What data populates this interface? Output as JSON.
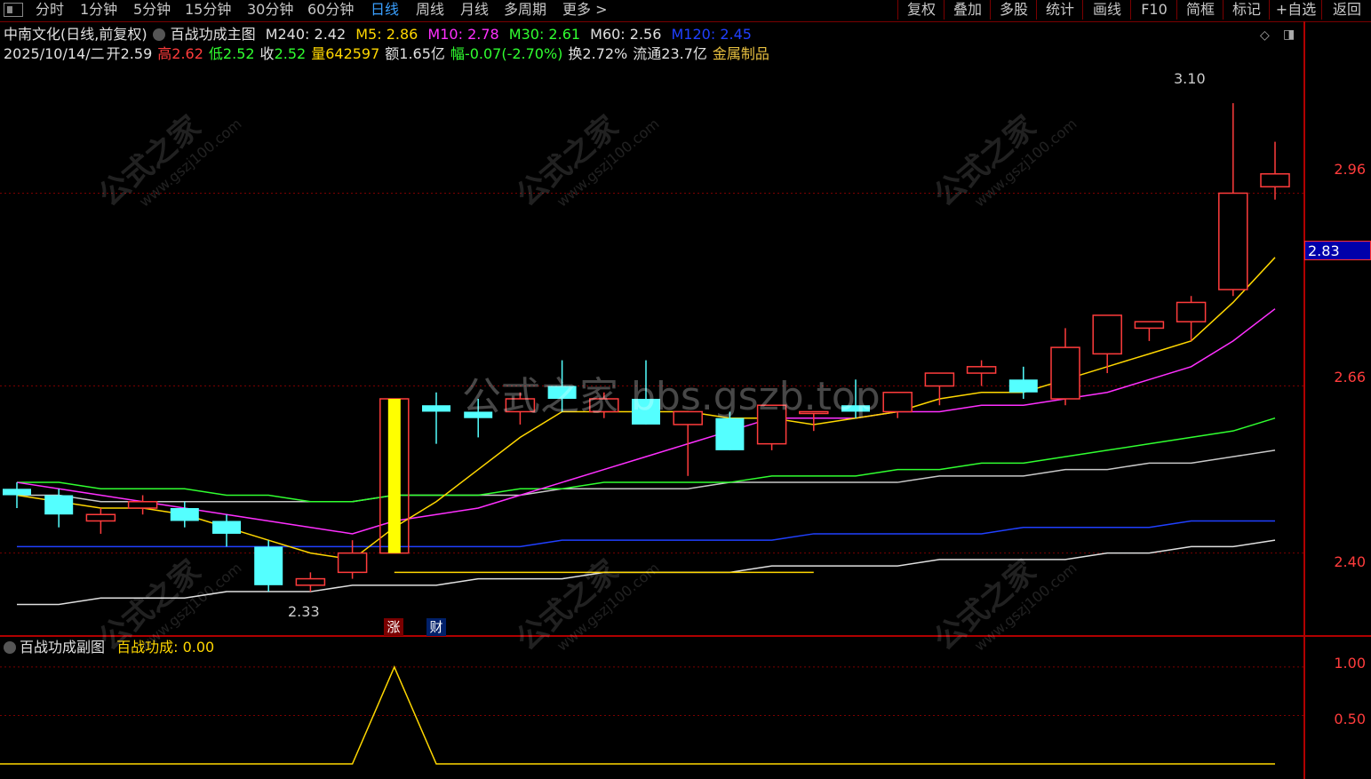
{
  "toolbar": {
    "periods": [
      "分时",
      "1分钟",
      "5分钟",
      "15分钟",
      "30分钟",
      "60分钟",
      "日线",
      "周线",
      "月线",
      "多周期",
      "更多 >"
    ],
    "active_period": "日线",
    "buttons": [
      "复权",
      "叠加",
      "多股",
      "统计",
      "画线",
      "F10",
      "简框",
      "标记",
      "+自选",
      "返回"
    ]
  },
  "header": {
    "stock": "中南文化(日线,前复权)",
    "indicator": "百战功成主图",
    "m240": "M240: 2.42",
    "m5": "M5: 2.86",
    "m10": "M10: 2.78",
    "m30": "M30: 2.61",
    "m60": "M60: 2.56",
    "m120": "M120: 2.45"
  },
  "quote": {
    "date": "2025/10/14/二",
    "open": "开2.59",
    "high_label": "高",
    "high": "2.62",
    "low_label": "低",
    "low": "2.52",
    "close_label": "收",
    "close": "2.52",
    "vol_label": "量",
    "vol": "642597",
    "amount": "额1.65亿",
    "change_label": "幅",
    "change": "-0.07(-2.70%)",
    "turnover": "换2.72%",
    "float": "流通23.7亿",
    "industry": "金属制品"
  },
  "axis": {
    "price_labels": [
      "2.96",
      "2.66",
      "2.40"
    ],
    "current_price": "2.83",
    "sub_labels": [
      "1.00",
      "0.50"
    ]
  },
  "annotations": {
    "high_mark": "3.10",
    "low_mark": "2.33",
    "tag_zhang": "涨",
    "tag_cai": "财"
  },
  "sub_panel": {
    "title": "百战功成副图",
    "value_label": "百战功成: 0.00"
  },
  "watermark": {
    "center": "公式之家 bbs.gszb.top",
    "text": "公式之家",
    "url": "www.gszj100.com"
  },
  "colors": {
    "up": "#ff3c3c",
    "down": "#54ffff",
    "m5": "#ffd700",
    "m10": "#ff30ff",
    "m30": "#30ff30",
    "m60": "#e0e0e0",
    "m120": "#2040ff",
    "m240": "#e0e0e0"
  },
  "chart_data": {
    "type": "candlestick",
    "candles": [
      {
        "o": 2.5,
        "h": 2.51,
        "l": 2.47,
        "c": 2.49
      },
      {
        "o": 2.49,
        "h": 2.5,
        "l": 2.44,
        "c": 2.46
      },
      {
        "o": 2.45,
        "h": 2.47,
        "l": 2.43,
        "c": 2.46
      },
      {
        "o": 2.47,
        "h": 2.49,
        "l": 2.46,
        "c": 2.48
      },
      {
        "o": 2.47,
        "h": 2.48,
        "l": 2.44,
        "c": 2.45
      },
      {
        "o": 2.45,
        "h": 2.46,
        "l": 2.41,
        "c": 2.43
      },
      {
        "o": 2.41,
        "h": 2.42,
        "l": 2.34,
        "c": 2.35
      },
      {
        "o": 2.35,
        "h": 2.37,
        "l": 2.34,
        "c": 2.36
      },
      {
        "o": 2.37,
        "h": 2.42,
        "l": 2.36,
        "c": 2.4
      },
      {
        "o": 2.4,
        "h": 2.64,
        "l": 2.4,
        "c": 2.64,
        "highlight": true
      },
      {
        "o": 2.63,
        "h": 2.65,
        "l": 2.57,
        "c": 2.62
      },
      {
        "o": 2.62,
        "h": 2.64,
        "l": 2.58,
        "c": 2.61
      },
      {
        "o": 2.62,
        "h": 2.65,
        "l": 2.6,
        "c": 2.64
      },
      {
        "o": 2.66,
        "h": 2.7,
        "l": 2.62,
        "c": 2.64
      },
      {
        "o": 2.62,
        "h": 2.65,
        "l": 2.61,
        "c": 2.64
      },
      {
        "o": 2.64,
        "h": 2.7,
        "l": 2.6,
        "c": 2.6
      },
      {
        "o": 2.6,
        "h": 2.62,
        "l": 2.52,
        "c": 2.62
      },
      {
        "o": 2.61,
        "h": 2.62,
        "l": 2.56,
        "c": 2.56
      },
      {
        "o": 2.57,
        "h": 2.63,
        "l": 2.56,
        "c": 2.63
      },
      {
        "o": 2.62,
        "h": 2.62,
        "l": 2.59,
        "c": 2.62
      },
      {
        "o": 2.63,
        "h": 2.67,
        "l": 2.61,
        "c": 2.62
      },
      {
        "o": 2.62,
        "h": 2.65,
        "l": 2.61,
        "c": 2.65
      },
      {
        "o": 2.66,
        "h": 2.68,
        "l": 2.63,
        "c": 2.68
      },
      {
        "o": 2.68,
        "h": 2.7,
        "l": 2.66,
        "c": 2.69
      },
      {
        "o": 2.67,
        "h": 2.69,
        "l": 2.64,
        "c": 2.65
      },
      {
        "o": 2.64,
        "h": 2.75,
        "l": 2.63,
        "c": 2.72
      },
      {
        "o": 2.71,
        "h": 2.74,
        "l": 2.68,
        "c": 2.77
      },
      {
        "o": 2.75,
        "h": 2.76,
        "l": 2.73,
        "c": 2.76
      },
      {
        "o": 2.76,
        "h": 2.8,
        "l": 2.73,
        "c": 2.79
      },
      {
        "o": 2.81,
        "h": 3.1,
        "l": 2.8,
        "c": 2.96
      },
      {
        "o": 2.97,
        "h": 3.04,
        "l": 2.95,
        "c": 2.99
      }
    ],
    "ma": {
      "m5": [
        2.49,
        2.48,
        2.47,
        2.47,
        2.46,
        2.44,
        2.42,
        2.4,
        2.39,
        2.44,
        2.48,
        2.53,
        2.58,
        2.62,
        2.62,
        2.62,
        2.62,
        2.61,
        2.61,
        2.6,
        2.61,
        2.62,
        2.64,
        2.65,
        2.65,
        2.67,
        2.69,
        2.71,
        2.73,
        2.79,
        2.86
      ],
      "m10": [
        2.51,
        2.5,
        2.49,
        2.48,
        2.47,
        2.46,
        2.45,
        2.44,
        2.43,
        2.45,
        2.46,
        2.47,
        2.49,
        2.51,
        2.53,
        2.55,
        2.57,
        2.59,
        2.61,
        2.61,
        2.61,
        2.62,
        2.62,
        2.63,
        2.63,
        2.64,
        2.65,
        2.67,
        2.69,
        2.73,
        2.78
      ],
      "m30": [
        2.51,
        2.51,
        2.5,
        2.5,
        2.5,
        2.49,
        2.49,
        2.48,
        2.48,
        2.49,
        2.49,
        2.49,
        2.5,
        2.5,
        2.51,
        2.51,
        2.51,
        2.51,
        2.52,
        2.52,
        2.52,
        2.53,
        2.53,
        2.54,
        2.54,
        2.55,
        2.56,
        2.57,
        2.58,
        2.59,
        2.61
      ],
      "m60": [
        2.49,
        2.49,
        2.48,
        2.48,
        2.48,
        2.48,
        2.48,
        2.48,
        2.48,
        2.49,
        2.49,
        2.49,
        2.49,
        2.5,
        2.5,
        2.5,
        2.5,
        2.51,
        2.51,
        2.51,
        2.51,
        2.51,
        2.52,
        2.52,
        2.52,
        2.53,
        2.53,
        2.54,
        2.54,
        2.55,
        2.56
      ],
      "m120": [
        2.41,
        2.41,
        2.41,
        2.41,
        2.41,
        2.41,
        2.41,
        2.41,
        2.41,
        2.41,
        2.41,
        2.41,
        2.41,
        2.42,
        2.42,
        2.42,
        2.42,
        2.42,
        2.42,
        2.43,
        2.43,
        2.43,
        2.43,
        2.43,
        2.44,
        2.44,
        2.44,
        2.44,
        2.45,
        2.45,
        2.45
      ],
      "m240": [
        2.32,
        2.32,
        2.33,
        2.33,
        2.33,
        2.34,
        2.34,
        2.34,
        2.35,
        2.35,
        2.35,
        2.36,
        2.36,
        2.36,
        2.37,
        2.37,
        2.37,
        2.37,
        2.38,
        2.38,
        2.38,
        2.38,
        2.39,
        2.39,
        2.39,
        2.39,
        2.4,
        2.4,
        2.41,
        2.41,
        2.42
      ]
    },
    "sub_series": [
      0,
      0,
      0,
      0,
      0,
      0,
      0,
      0,
      0,
      1,
      0,
      0,
      0,
      0,
      0,
      0,
      0,
      0,
      0,
      0,
      0,
      0,
      0,
      0,
      0,
      0,
      0,
      0,
      0,
      0,
      0
    ],
    "ylim": [
      2.3,
      3.15
    ],
    "sub_ylim": [
      0,
      1.1
    ]
  }
}
